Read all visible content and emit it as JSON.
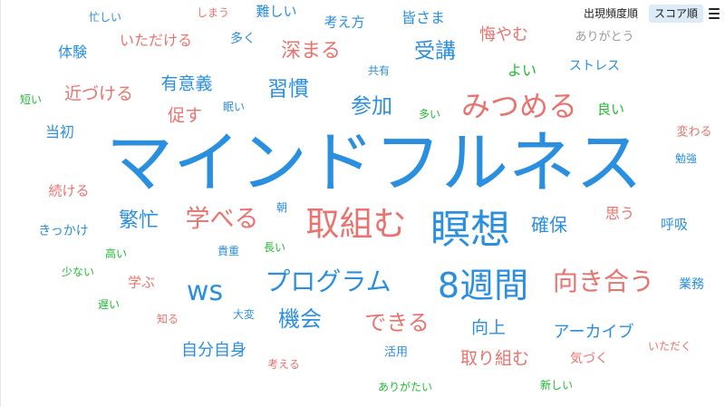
{
  "toolbar": {
    "freq_label": "出現頻度順",
    "score_label": "スコア順"
  },
  "colors": {
    "blue": "#2b8fe0",
    "red": "#e8736f",
    "green": "#22bb33",
    "gray": "#9a9a9a"
  },
  "words": [
    {
      "text": "マインドフルネス",
      "color": "blue"
    },
    {
      "text": "瞑想",
      "color": "blue"
    },
    {
      "text": "取組む",
      "color": "red"
    },
    {
      "text": "8週間",
      "color": "blue"
    },
    {
      "text": "みつめる",
      "color": "red"
    },
    {
      "text": "ws",
      "color": "blue"
    },
    {
      "text": "プログラム",
      "color": "blue"
    },
    {
      "text": "向き合う",
      "color": "red"
    },
    {
      "text": "学べる",
      "color": "red"
    },
    {
      "text": "繁忙",
      "color": "blue"
    },
    {
      "text": "できる",
      "color": "red"
    },
    {
      "text": "機会",
      "color": "blue"
    },
    {
      "text": "受講",
      "color": "blue"
    },
    {
      "text": "参加",
      "color": "blue"
    },
    {
      "text": "習慣",
      "color": "blue"
    },
    {
      "text": "深まる",
      "color": "red"
    },
    {
      "text": "確保",
      "color": "blue"
    },
    {
      "text": "向上",
      "color": "blue"
    },
    {
      "text": "取り組む",
      "color": "red"
    },
    {
      "text": "アーカイブ",
      "color": "blue"
    },
    {
      "text": "自分自身",
      "color": "blue"
    },
    {
      "text": "有意義",
      "color": "blue"
    },
    {
      "text": "近づける",
      "color": "red"
    },
    {
      "text": "促す",
      "color": "red"
    },
    {
      "text": "悔やむ",
      "color": "red"
    },
    {
      "text": "皆さま",
      "color": "blue"
    },
    {
      "text": "考え方",
      "color": "blue"
    },
    {
      "text": "難しい",
      "color": "blue"
    },
    {
      "text": "いただける",
      "color": "red"
    },
    {
      "text": "体験",
      "color": "blue"
    },
    {
      "text": "当初",
      "color": "blue"
    },
    {
      "text": "続ける",
      "color": "red"
    },
    {
      "text": "きっかけ",
      "color": "blue"
    },
    {
      "text": "学ぶ",
      "color": "red"
    },
    {
      "text": "思う",
      "color": "red"
    },
    {
      "text": "呼吸",
      "color": "blue"
    },
    {
      "text": "業務",
      "color": "blue"
    },
    {
      "text": "よい",
      "color": "green"
    },
    {
      "text": "ストレス",
      "color": "blue"
    },
    {
      "text": "ありがとう",
      "color": "gray"
    },
    {
      "text": "良い",
      "color": "green"
    },
    {
      "text": "変わる",
      "color": "red"
    },
    {
      "text": "勉強",
      "color": "blue"
    },
    {
      "text": "多く",
      "color": "blue"
    },
    {
      "text": "共有",
      "color": "blue"
    },
    {
      "text": "しまう",
      "color": "red"
    },
    {
      "text": "忙しい",
      "color": "blue"
    },
    {
      "text": "短い",
      "color": "green"
    },
    {
      "text": "眠い",
      "color": "blue"
    },
    {
      "text": "多い",
      "color": "green"
    },
    {
      "text": "朝",
      "color": "blue"
    },
    {
      "text": "高い",
      "color": "green"
    },
    {
      "text": "貴重",
      "color": "blue"
    },
    {
      "text": "長い",
      "color": "green"
    },
    {
      "text": "少ない",
      "color": "green"
    },
    {
      "text": "遅い",
      "color": "green"
    },
    {
      "text": "知る",
      "color": "red"
    },
    {
      "text": "大変",
      "color": "blue"
    },
    {
      "text": "考える",
      "color": "red"
    },
    {
      "text": "活用",
      "color": "blue"
    },
    {
      "text": "気づく",
      "color": "red"
    },
    {
      "text": "いただく",
      "color": "red"
    },
    {
      "text": "ありがたい",
      "color": "green"
    },
    {
      "text": "新しい",
      "color": "green"
    }
  ]
}
